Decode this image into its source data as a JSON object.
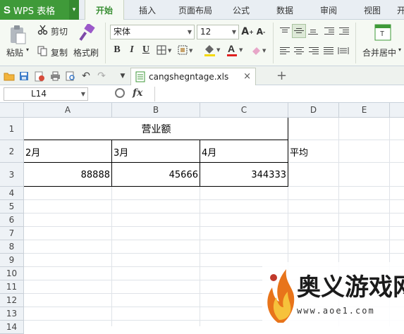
{
  "app": {
    "logo": "S",
    "name": "WPS 表格",
    "caret": "▾"
  },
  "menu": {
    "tabs": [
      {
        "label": "开始",
        "active": true
      },
      {
        "label": "插入"
      },
      {
        "label": "页面布局"
      },
      {
        "label": "公式"
      },
      {
        "label": "数据"
      },
      {
        "label": "审阅"
      },
      {
        "label": "视图"
      },
      {
        "label": "开"
      }
    ]
  },
  "ribbon": {
    "paste": "粘贴",
    "cut": "剪切",
    "copy": "复制",
    "format_painter": "格式刷",
    "font_name": "宋体",
    "font_size": "12",
    "bold": "B",
    "italic": "I",
    "underline": "U",
    "merge_center": "合并居中",
    "font_color": "#e02020",
    "fill_color": "#f5d90a"
  },
  "quickbar": {
    "doc_name": "cangshegntage.xls",
    "close": "×",
    "add": "+"
  },
  "formula_bar": {
    "cell_ref": "L14",
    "fx": "fx",
    "value": ""
  },
  "sheet": {
    "columns": [
      "A",
      "B",
      "C",
      "D",
      "E"
    ],
    "rows": [
      "1",
      "2",
      "3",
      "4",
      "5",
      "6",
      "7",
      "8",
      "9",
      "10",
      "11",
      "12",
      "13",
      "14"
    ],
    "cells": {
      "title": "营业额",
      "a2": "2月",
      "b2": "3月",
      "c2": "4月",
      "d2": "平均",
      "a3": "88888",
      "b3": "45666",
      "c3": "344333"
    }
  },
  "watermark": {
    "title": "奥义游戏网",
    "url": "www.aoe1.com",
    "brand_color": "#e8741a"
  }
}
